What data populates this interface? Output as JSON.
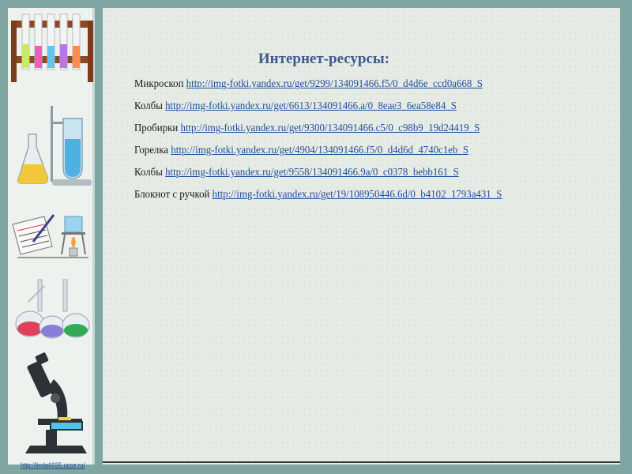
{
  "slide": {
    "title": "Интернет-ресурсы:",
    "footer_link": "http://linda6035.ucoz.ru/"
  },
  "resources": [
    {
      "label": "Микроскоп",
      "url": "http://img-fotki.yandex.ru/get/9299/134091466.f5/0_d4d6e_ccd0a668_S"
    },
    {
      "label": "Колбы",
      "url": "http://img-fotki.yandex.ru/get/6613/134091466.a/0_8eae3_6ea58e84_S"
    },
    {
      "label": "Пробирки",
      "url": "http://img-fotki.yandex.ru/get/9300/134091466.c5/0_c98b9_19d24419_S"
    },
    {
      "label": "Горелка ",
      "url": "http://img-fotki.yandex.ru/get/4904/134091466.f5/0_d4d6d_4740c1eb_S"
    },
    {
      "label": "Колбы",
      "url": "http://img-fotki.yandex.ru/get/9558/134091466.9a/0_c0378_bebb161_S"
    },
    {
      "label": "Блокнот с ручкой",
      "url": "http://img-fotki.yandex.ru/get/19/108950446.6d/0_b4102_1793a431_S"
    }
  ],
  "colors": {
    "background": "#7fa6a2",
    "content_panel": "#e6ebe6",
    "title": "#3d5b8a",
    "link": "#1f4f9a"
  },
  "icons": [
    "test-tube-rack-icon",
    "flasks-stand-icon",
    "notebook-burner-icon",
    "colored-flasks-icon",
    "microscope-icon"
  ]
}
